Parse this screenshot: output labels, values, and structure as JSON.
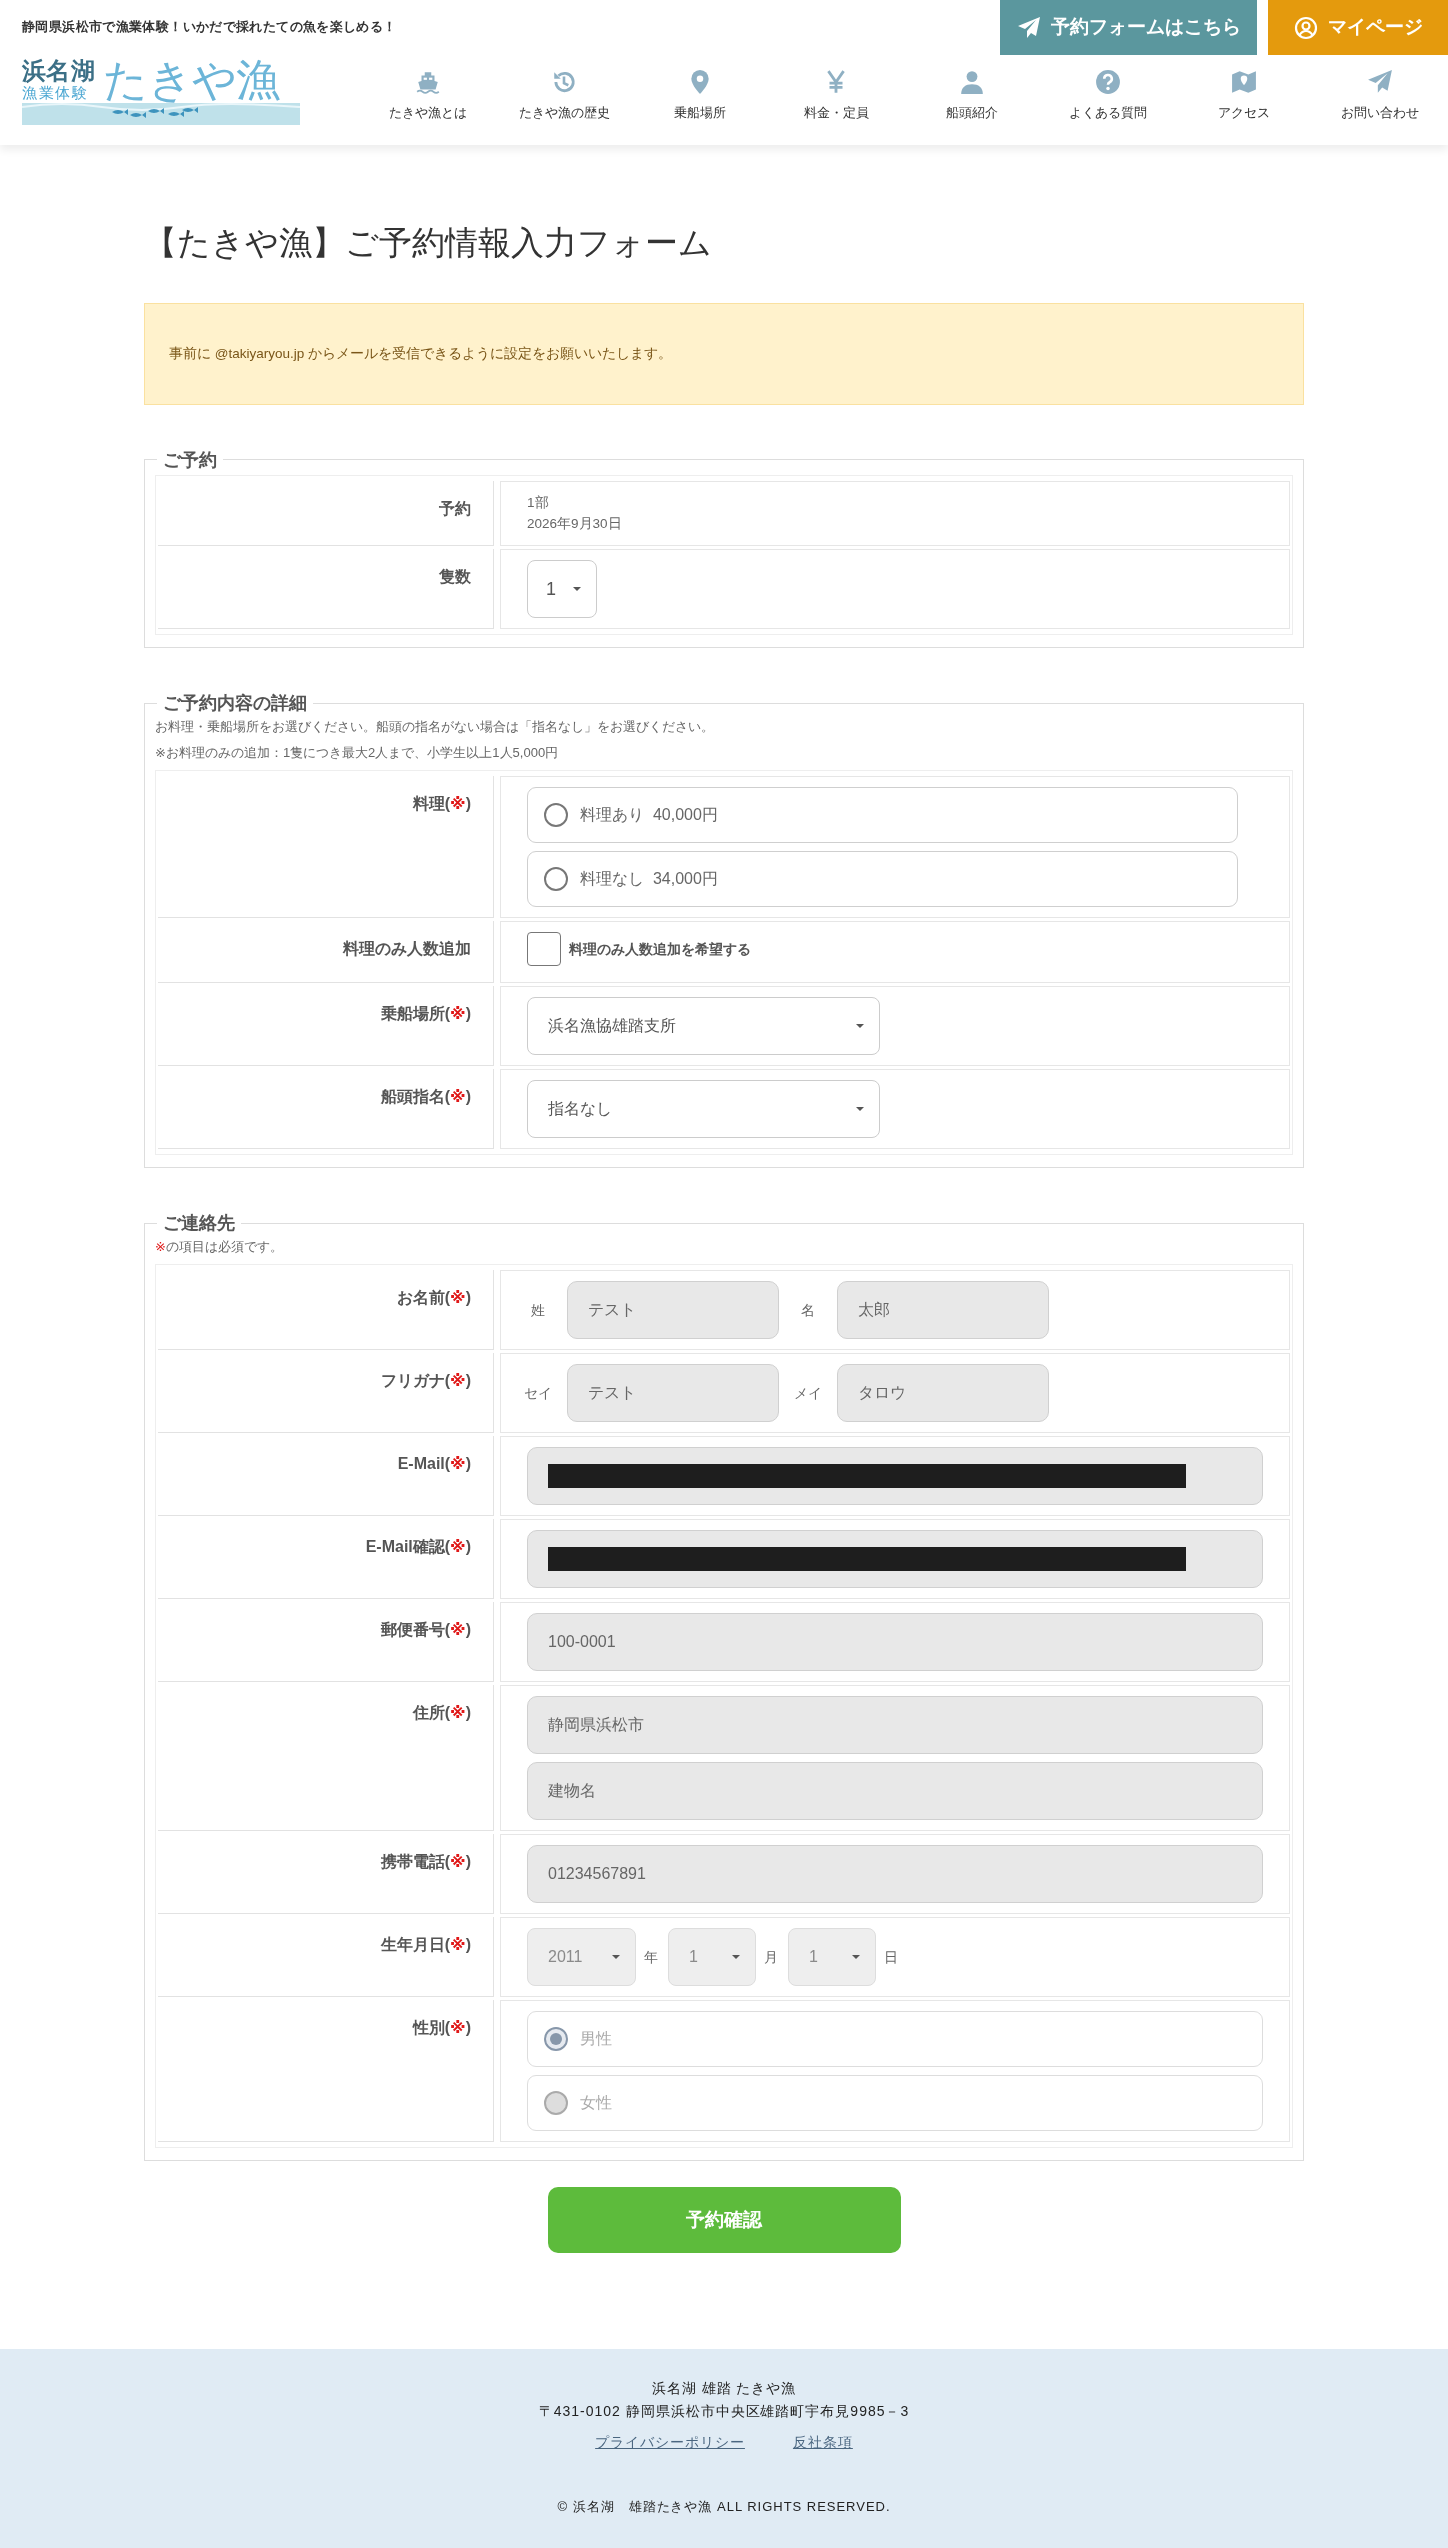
{
  "header": {
    "tagline": "静岡県浜松市で漁業体験！いかだで採れたての魚を楽しめる！",
    "buttons": [
      {
        "label": "予約フォームはこちら",
        "kind": "reserve"
      },
      {
        "label": "マイページ",
        "kind": "mypage"
      }
    ],
    "logo": {
      "line1": "浜名湖",
      "line2": "漁業体験",
      "name": "たきや漁"
    },
    "nav": [
      {
        "label": "たきや漁とは"
      },
      {
        "label": "たきや漁の歴史"
      },
      {
        "label": "乗船場所"
      },
      {
        "label": "料金・定員"
      },
      {
        "label": "船頭紹介"
      },
      {
        "label": "よくある質問"
      },
      {
        "label": "アクセス"
      },
      {
        "label": "お問い合わせ"
      }
    ]
  },
  "page_title": "【たきや漁】ご予約情報入力フォーム",
  "notice": "事前に @takiyaryou.jp からメールを受信できるように設定をお願いいたします。",
  "sections": [
    {
      "legend": "ご予約",
      "rows": [
        {
          "label": "予約",
          "controls": [
            {
              "kind": "text",
              "lines": [
                "1部",
                "2026年9月30日"
              ]
            }
          ]
        },
        {
          "label": "隻数",
          "controls": [
            {
              "kind": "select",
              "value": "1"
            }
          ]
        }
      ]
    },
    {
      "legend": "ご予約内容の詳細",
      "notes": [
        {
          "text": "お料理・乗船場所をお選びください。船頭の指名がない場合は「指名なし」をお選びください。"
        },
        {
          "text": "※お料理のみの追加：1隻につき最大2人まで、小学生以上1人5,000円"
        }
      ],
      "rows": [
        {
          "label": "料理(",
          "mark": "※",
          "label_end": ")",
          "controls": [
            {
              "kind": "radio_group",
              "disabled": false,
              "options": [
                {
                  "label": "料理あり  40,000円",
                  "selected": false
                },
                {
                  "label": "料理なし  34,000円",
                  "selected": false
                }
              ]
            }
          ]
        },
        {
          "label": "料理のみ人数追加",
          "controls": [
            {
              "kind": "checkbox",
              "label": "料理のみ人数追加を希望する",
              "checked": false
            }
          ]
        },
        {
          "label": "乗船場所(",
          "mark": "※",
          "label_end": ")",
          "controls": [
            {
              "kind": "select_wide",
              "value": "浜名漁協雄踏支所"
            }
          ]
        },
        {
          "label": "船頭指名(",
          "mark": "※",
          "label_end": ")",
          "controls": [
            {
              "kind": "select_wide",
              "value": "指名なし"
            }
          ]
        }
      ]
    },
    {
      "legend": "ご連絡先",
      "notes": [
        {
          "mark": "※",
          "text": "の項目は必須です。"
        }
      ],
      "rows": [
        {
          "label": "お名前(",
          "mark": "※",
          "label_end": ")",
          "controls": [
            {
              "kind": "name_pair",
              "parts": [
                {
                  "prefix": "姓",
                  "value": "テスト"
                },
                {
                  "prefix": "名",
                  "value": "太郎"
                }
              ]
            }
          ]
        },
        {
          "label": "フリガナ(",
          "mark": "※",
          "label_end": ")",
          "controls": [
            {
              "kind": "name_pair",
              "parts": [
                {
                  "prefix": "セイ",
                  "value": "テスト"
                },
                {
                  "prefix": "メイ",
                  "value": "タロウ"
                }
              ]
            }
          ]
        },
        {
          "label": "E-Mail(",
          "mark": "※",
          "label_end": ")",
          "controls": [
            {
              "kind": "input",
              "redacted": true
            }
          ]
        },
        {
          "label": "E-Mail確認(",
          "mark": "※",
          "label_end": ")",
          "controls": [
            {
              "kind": "input",
              "redacted": true
            }
          ]
        },
        {
          "label": "郵便番号(",
          "mark": "※",
          "label_end": ")",
          "controls": [
            {
              "kind": "input",
              "value": "100-0001"
            }
          ]
        },
        {
          "label": "住所(",
          "mark": "※",
          "label_end": ")",
          "controls": [
            {
              "kind": "input",
              "value": "静岡県浜松市"
            },
            {
              "kind": "input",
              "value": "建物名"
            }
          ]
        },
        {
          "label": "携帯電話(",
          "mark": "※",
          "label_end": ")",
          "controls": [
            {
              "kind": "input",
              "value": "01234567891"
            }
          ]
        },
        {
          "label": "生年月日(",
          "mark": "※",
          "label_end": ")",
          "controls": [
            {
              "kind": "date",
              "disabled": true,
              "parts": [
                {
                  "value": "2011",
                  "unit": "年"
                },
                {
                  "value": "1",
                  "unit": "月"
                },
                {
                  "value": "1",
                  "unit": "日"
                }
              ]
            }
          ]
        },
        {
          "label": "性別(",
          "mark": "※",
          "label_end": ")",
          "controls": [
            {
              "kind": "radio_group",
              "disabled": true,
              "options": [
                {
                  "label": "男性",
                  "selected": true
                },
                {
                  "label": "女性",
                  "selected": false
                }
              ]
            }
          ]
        }
      ]
    }
  ],
  "submit": "予約確認",
  "footer": {
    "name": "浜名湖 雄踏 たきや漁",
    "address": "〒431-0102 静岡県浜松市中央区雄踏町宇布見9985－3",
    "links": [
      "プライバシーポリシー",
      "反社条項"
    ],
    "copyright": "© 浜名湖　雄踏たきや漁 ALL RIGHTS RESERVED."
  }
}
